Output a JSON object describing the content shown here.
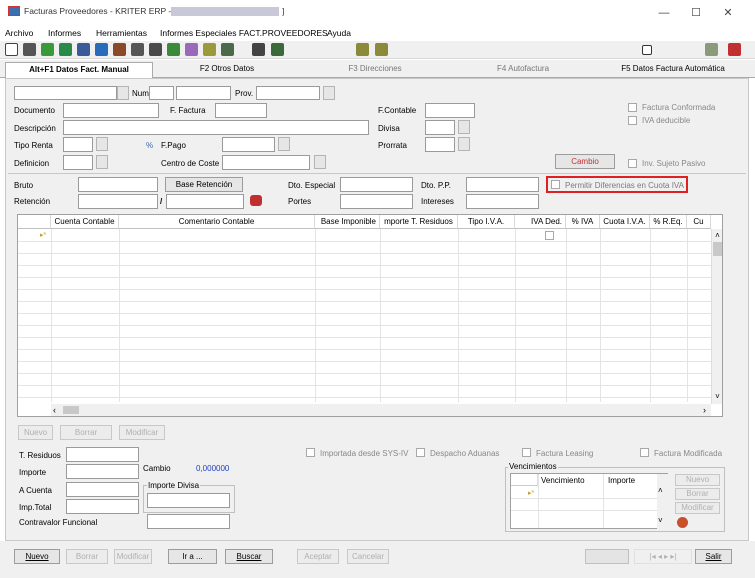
{
  "window": {
    "title": "Facturas Proveedores - KRITER ERP - [",
    "title_end": "]",
    "controls": {
      "minimize": "—",
      "maximize": "☐",
      "close": "✕"
    }
  },
  "menu": [
    "Archivo",
    "Informes",
    "Herramientas",
    "Informes Especiales FACT.PROVEEDORES",
    "Ayuda"
  ],
  "tabs": [
    "Alt+F1 Datos Fact. Manual",
    "F2 Otros Datos",
    "F3 Direcciones",
    "F4 Autofactura",
    "F5 Datos Factura Automática"
  ],
  "header": {
    "num_label": "Num.",
    "prov_label": "Prov.",
    "documento": "Documento",
    "f_factura": "F. Factura",
    "f_contable": "F.Contable",
    "descripcion": "Descripción",
    "divisa": "Divisa",
    "tipo_renta": "Tipo Renta",
    "pct": "%",
    "f_pago": "F.Pago",
    "prorrata": "Prorrata",
    "definicion": "Definicion",
    "centro_coste": "Centro de Coste",
    "factura_conformada": "Factura Conformada",
    "iva_deducible": "IVA deducible",
    "cambio_btn": "Cambio",
    "inv_sujeto_pasivo": "Inv. Sujeto Pasivo"
  },
  "totals": {
    "bruto": "Bruto",
    "base_retencion": "Base Retención",
    "dto_especial": "Dto. Especial",
    "dto_pp": "Dto. P.P.",
    "permitir": "Permitir Diferencias en Cuota IVA",
    "retencion": "Retención",
    "slash": "/",
    "portes": "Portes",
    "intereses": "Intereses"
  },
  "grid": {
    "columns": [
      "Cuenta Contable",
      "Comentario Contable",
      "Base Imponible",
      "mporte T. Residuos",
      "Tipo I.V.A.",
      "IVA Ded.",
      "% IVA",
      "Cuota I.V.A.",
      "% R.Eq.",
      "Cu"
    ],
    "row_marker": "▸*"
  },
  "grid_buttons": [
    "Nuevo",
    "Borrar",
    "Modificar"
  ],
  "lower": {
    "t_residuos": "T. Residuos",
    "importe": "Importe",
    "cambio": "Cambio",
    "cambio_value": "0,000000",
    "a_cuenta": "A Cuenta",
    "importe_divisa": "Importe Divisa",
    "imp_total": "Imp.Total",
    "contravalor": "Contravalor Funcional",
    "importada": "Importada desde SYS-IV",
    "despacho": "Despacho Aduanas",
    "leasing": "Factura Leasing",
    "modificada": "Factura Modificada"
  },
  "vencimientos": {
    "title": "Vencimientos",
    "col1": "Vencimiento",
    "col2": "Importe",
    "buttons": [
      "Nuevo",
      "Borrar",
      "Modificar"
    ]
  },
  "footer": {
    "nuevo": "Nuevo",
    "borrar": "Borrar",
    "modificar": "Modificar",
    "ira": "Ir a ...",
    "buscar": "Buscar",
    "aceptar": "Aceptar",
    "cancelar": "Cancelar",
    "nav": "|◂ ◂ ▸ ▸|",
    "salir": "Salir"
  }
}
